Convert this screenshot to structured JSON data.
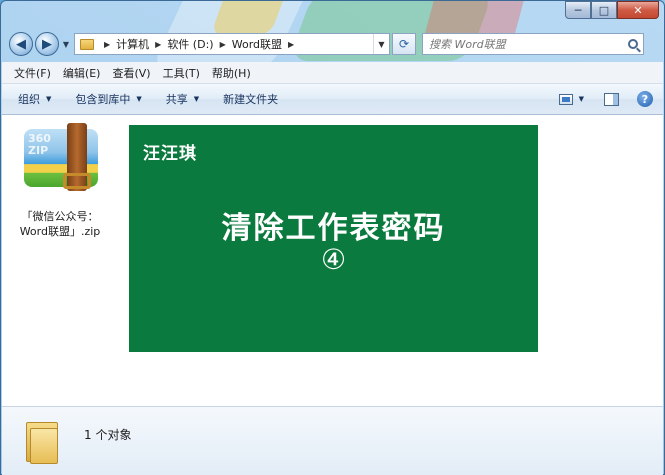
{
  "window": {
    "caption_buttons": {
      "minimize": "─",
      "maximize": "□",
      "close": "✕"
    }
  },
  "nav": {
    "back_icon": "◀",
    "forward_icon": "▶",
    "breadcrumbs": [
      "计算机",
      "软件 (D:)",
      "Word联盟"
    ],
    "refresh_icon": "⟳",
    "search_placeholder": "搜索 Word联盟"
  },
  "menubar": {
    "items": [
      "文件(F)",
      "编辑(E)",
      "查看(V)",
      "工具(T)",
      "帮助(H)"
    ]
  },
  "toolbar": {
    "organize": "组织",
    "include_library": "包含到库中",
    "share": "共享",
    "new_folder": "新建文件夹",
    "help_icon": "?"
  },
  "file": {
    "icon_text": "360\nZIP",
    "name_line1": "「微信公众号：",
    "name_line2": "Word联盟」.zip"
  },
  "preview": {
    "author": "汪汪琪",
    "title": "清除工作表密码",
    "number": "④",
    "background": "#0b7a3e"
  },
  "details": {
    "count": "1 个对象"
  }
}
